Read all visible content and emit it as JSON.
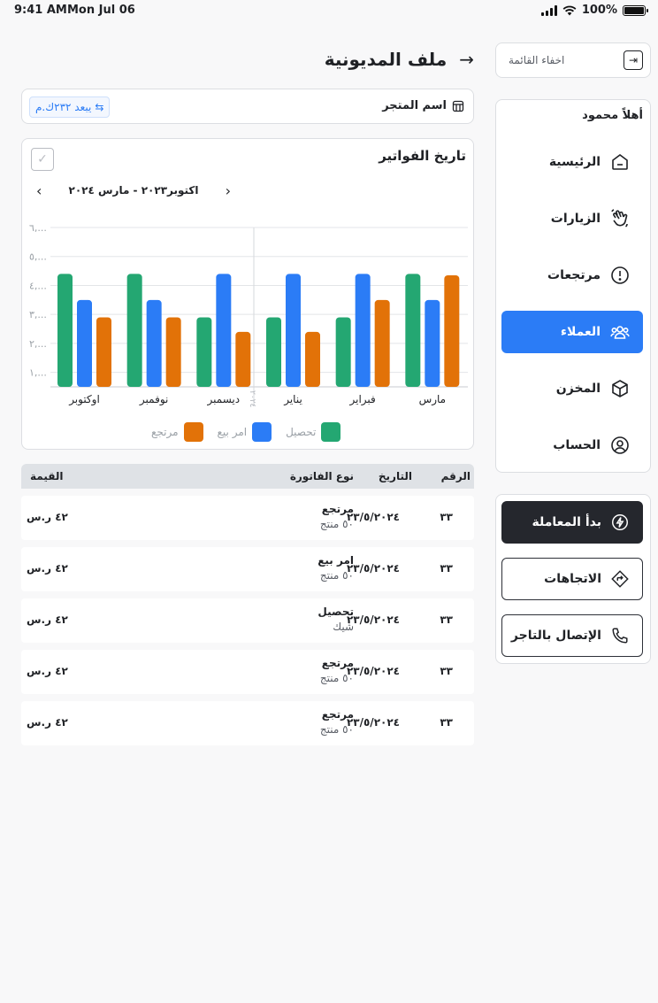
{
  "status": {
    "time": "9:41 AM",
    "date": "Mon Jul 06",
    "battery": "100%"
  },
  "sidebar": {
    "hide_menu": "اخفاء القائمة",
    "greeting": "أهلاً محمود",
    "items": [
      {
        "label": "الرئيسية",
        "icon": "home-icon"
      },
      {
        "label": "الزيارات",
        "icon": "hand-wave-icon"
      },
      {
        "label": "مرتجعات",
        "icon": "alert-circle-icon"
      },
      {
        "label": "العملاء",
        "icon": "users-icon",
        "active": true
      },
      {
        "label": "المخزن",
        "icon": "box-icon"
      },
      {
        "label": "الحساب",
        "icon": "user-circle-icon"
      }
    ],
    "actions": {
      "start": "بدأ المعاملة",
      "directions": "الاتجاهات",
      "call": "الإتصال بالتاجر"
    }
  },
  "header": {
    "title": "ملف المديونية"
  },
  "store": {
    "name": "اسم المتجر",
    "distance": "يبعد ٢٣٢ك.م"
  },
  "chart_card": {
    "title": "تاريخ الفواتير",
    "range": "اكتوبر٢٠٢٣ - مارس ٢٠٢٤"
  },
  "chart_data": {
    "type": "bar",
    "categories": [
      "اوكتوبر",
      "نوفمبر",
      "ديسمبر",
      "يناير",
      "فبراير",
      "مارس"
    ],
    "divider_label": "٢٠٢٤",
    "y_ticks": [
      "١,...",
      "٢,...",
      "٣,...",
      "٤,...",
      "٥,...",
      "٦,..."
    ],
    "ylim": [
      500,
      6000
    ],
    "series": [
      {
        "name": "تحصيل",
        "color": "#24a772",
        "values": [
          4400,
          4400,
          2900,
          2900,
          2900,
          4400
        ]
      },
      {
        "name": "امر بيع",
        "color": "#2b7cf6",
        "values": [
          3500,
          3500,
          4400,
          4400,
          4400,
          3500
        ]
      },
      {
        "name": "مرتجع",
        "color": "#e27208",
        "values": [
          2900,
          2900,
          2400,
          2400,
          3500,
          4350
        ]
      }
    ]
  },
  "table": {
    "headers": {
      "num": "الرقم",
      "date": "التاريخ",
      "type": "نوع الفاتورة",
      "value": "القيمة"
    },
    "rows": [
      {
        "num": "٣٣",
        "date": "٢٣/٥/٢٠٢٤",
        "type": "مرتجع",
        "sub": "٥٠ منتج",
        "value": "٤٢ ر.س"
      },
      {
        "num": "٣٣",
        "date": "٢٣/٥/٢٠٢٤",
        "type": "امر بيع",
        "sub": "٥٠ منتج",
        "value": "٤٢ ر.س"
      },
      {
        "num": "٣٣",
        "date": "٢٣/٥/٢٠٢٤",
        "type": "تحصيل",
        "sub": "شيك",
        "value": "٤٢ ر.س"
      },
      {
        "num": "٣٣",
        "date": "٢٣/٥/٢٠٢٤",
        "type": "مرتجع",
        "sub": "٥٠ منتج",
        "value": "٤٢ ر.س"
      },
      {
        "num": "٣٣",
        "date": "٢٣/٥/٢٠٢٤",
        "type": "مرتجع",
        "sub": "٥٠ منتج",
        "value": "٤٢ ر.س"
      }
    ]
  }
}
